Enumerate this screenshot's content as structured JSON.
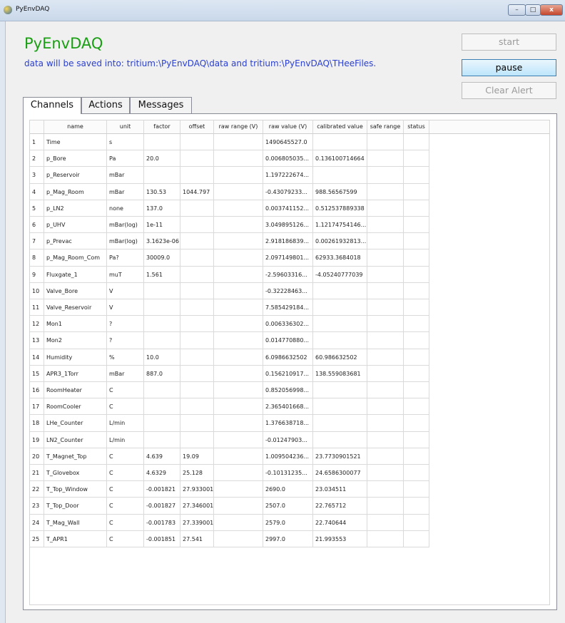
{
  "window": {
    "title": "PyEnvDAQ",
    "min_glyph": "–",
    "max_glyph": "□",
    "close_glyph": "x"
  },
  "header": {
    "app_title": "PyEnvDAQ",
    "save_path_text": "data will be saved into: tritium:\\PyEnvDAQ\\data and tritium:\\PyEnvDAQ\\THeeFiles."
  },
  "buttons": {
    "start": "start",
    "pause": "pause",
    "clear_alert": "Clear Alert"
  },
  "tabs": [
    "Channels",
    "Actions",
    "Messages"
  ],
  "table": {
    "columns": [
      "name",
      "unit",
      "factor",
      "offset",
      "raw range (V)",
      "raw value (V)",
      "calibrated value",
      "safe range",
      "status"
    ],
    "rows": [
      [
        "1",
        "Time",
        "s",
        "",
        "",
        "",
        "1490645527.0",
        "",
        "",
        ""
      ],
      [
        "2",
        "p_Bore",
        "Pa",
        "20.0",
        "",
        "",
        "0.006805035...",
        "0.136100714664",
        "",
        ""
      ],
      [
        "3",
        "p_Reservoir",
        "mBar",
        "",
        "",
        "",
        "1.197222674...",
        "",
        "",
        ""
      ],
      [
        "4",
        "p_Mag_Room",
        "mBar",
        "130.53",
        "1044.797",
        "",
        "-0.43079233...",
        "988.56567599",
        "",
        ""
      ],
      [
        "5",
        "p_LN2",
        "none",
        "137.0",
        "",
        "",
        "0.003741152...",
        "0.512537889338",
        "",
        ""
      ],
      [
        "6",
        "p_UHV",
        "mBar(log)",
        "1e-11",
        "",
        "",
        "3.049895126...",
        "1.12174754146...",
        "",
        ""
      ],
      [
        "7",
        "p_Prevac",
        "mBar(log)",
        "3.1623e-06",
        "",
        "",
        "2.918186839...",
        "0.00261932813...",
        "",
        ""
      ],
      [
        "8",
        "p_Mag_Room_Com",
        "Pa?",
        "30009.0",
        "",
        "",
        "2.097149801...",
        "62933.3684018",
        "",
        ""
      ],
      [
        "9",
        "Fluxgate_1",
        "muT",
        "1.561",
        "",
        "",
        "-2.59603316...",
        "-4.05240777039",
        "",
        ""
      ],
      [
        "10",
        "Valve_Bore",
        "V",
        "",
        "",
        "",
        "-0.32228463...",
        "",
        "",
        ""
      ],
      [
        "11",
        "Valve_Reservoir",
        "V",
        "",
        "",
        "",
        "7.585429184...",
        "",
        "",
        ""
      ],
      [
        "12",
        "Mon1",
        "?",
        "",
        "",
        "",
        "0.006336302...",
        "",
        "",
        ""
      ],
      [
        "13",
        "Mon2",
        "?",
        "",
        "",
        "",
        "0.014770880...",
        "",
        "",
        ""
      ],
      [
        "14",
        "Humidity",
        "%",
        "10.0",
        "",
        "",
        "6.0986632502",
        "60.986632502",
        "",
        ""
      ],
      [
        "15",
        "APR3_1Torr",
        "mBar",
        "887.0",
        "",
        "",
        "0.156210917...",
        "138.559083681",
        "",
        ""
      ],
      [
        "16",
        "RoomHeater",
        "C",
        "",
        "",
        "",
        "0.852056998...",
        "",
        "",
        ""
      ],
      [
        "17",
        "RoomCooler",
        "C",
        "",
        "",
        "",
        "2.365401668...",
        "",
        "",
        ""
      ],
      [
        "18",
        "LHe_Counter",
        "L/min",
        "",
        "",
        "",
        "1.376638718...",
        "",
        "",
        ""
      ],
      [
        "19",
        "LN2_Counter",
        "L/min",
        "",
        "",
        "",
        "-0.01247903...",
        "",
        "",
        ""
      ],
      [
        "20",
        "T_Magnet_Top",
        "C",
        "4.639",
        "19.09",
        "",
        "1.009504236...",
        "23.7730901521",
        "",
        ""
      ],
      [
        "21",
        "T_Glovebox",
        "C",
        "4.6329",
        "25.128",
        "",
        "-0.10131235...",
        "24.6586300077",
        "",
        ""
      ],
      [
        "22",
        "T_Top_Window",
        "C",
        "-0.001821",
        "27.933001",
        "",
        "2690.0",
        "23.034511",
        "",
        ""
      ],
      [
        "23",
        "T_Top_Door",
        "C",
        "-0.001827",
        "27.346001",
        "",
        "2507.0",
        "22.765712",
        "",
        ""
      ],
      [
        "24",
        "T_Mag_Wall",
        "C",
        "-0.001783",
        "27.339001",
        "",
        "2579.0",
        "22.740644",
        "",
        ""
      ],
      [
        "25",
        "T_APR1",
        "C",
        "-0.001851",
        "27.541",
        "",
        "2997.0",
        "21.993553",
        "",
        ""
      ]
    ]
  }
}
